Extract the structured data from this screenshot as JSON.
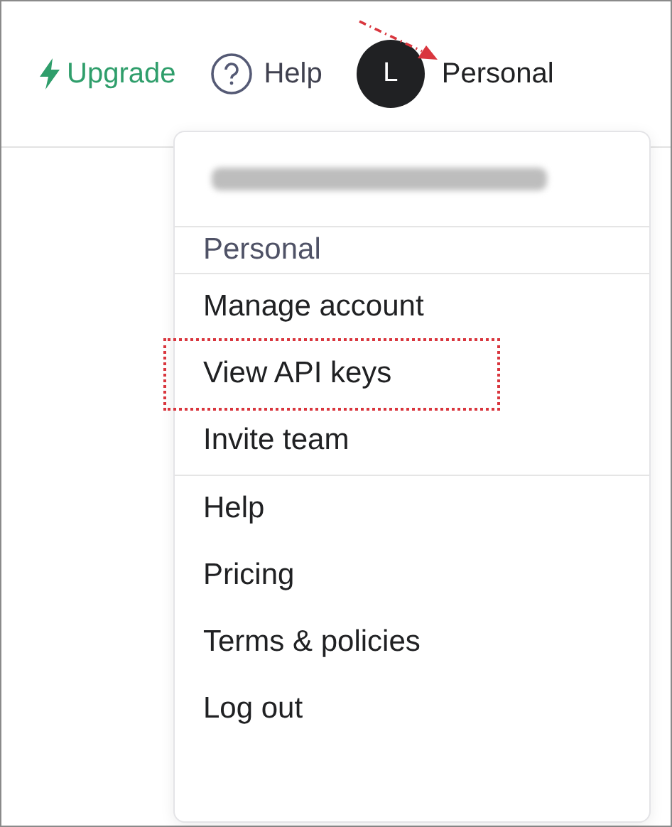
{
  "header": {
    "upgrade": {
      "label": "Upgrade"
    },
    "help": {
      "label": "Help"
    },
    "account": {
      "avatar_letter": "L",
      "label": "Personal",
      "annotated": true
    }
  },
  "menu": {
    "email_redacted": true,
    "sections": [
      {
        "items": [
          {
            "label": "Personal",
            "kind": "heading",
            "highlighted": false
          }
        ]
      },
      {
        "items": [
          {
            "label": "Manage account",
            "kind": "link",
            "highlighted": false
          },
          {
            "label": "View API keys",
            "kind": "link",
            "highlighted": true
          },
          {
            "label": "Invite team",
            "kind": "link",
            "highlighted": false
          }
        ]
      },
      {
        "items": [
          {
            "label": "Help",
            "kind": "link",
            "highlighted": false
          },
          {
            "label": "Pricing",
            "kind": "link",
            "highlighted": false
          },
          {
            "label": "Terms & policies",
            "kind": "link",
            "highlighted": false
          },
          {
            "label": "Log out",
            "kind": "link",
            "highlighted": false
          }
        ]
      }
    ]
  }
}
